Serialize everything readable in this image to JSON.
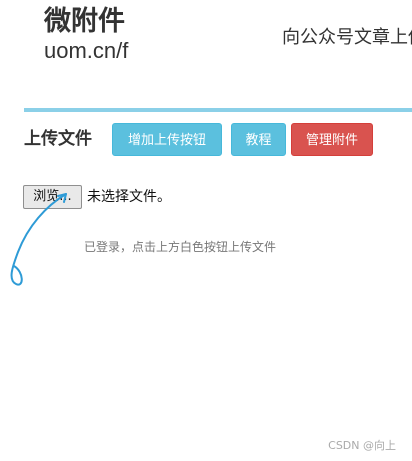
{
  "header": {
    "logo_title": "微附件",
    "logo_url": "uom.cn/f",
    "tagline": "向公众号文章上传附件"
  },
  "upload": {
    "section_title": "上传文件",
    "buttons": {
      "add_upload": "增加上传按钮",
      "tutorial": "教程",
      "manage": "管理附件"
    },
    "file_input": {
      "browse_label": "浏览...",
      "status": "未选择文件。"
    },
    "hint": "已登录，点击上方白色按钮上传文件"
  },
  "colors": {
    "info": "#5bc0de",
    "danger": "#d9534f",
    "divider": "#8bd0e8",
    "arrow": "#2e9bd6"
  },
  "watermark": "CSDN @向上"
}
